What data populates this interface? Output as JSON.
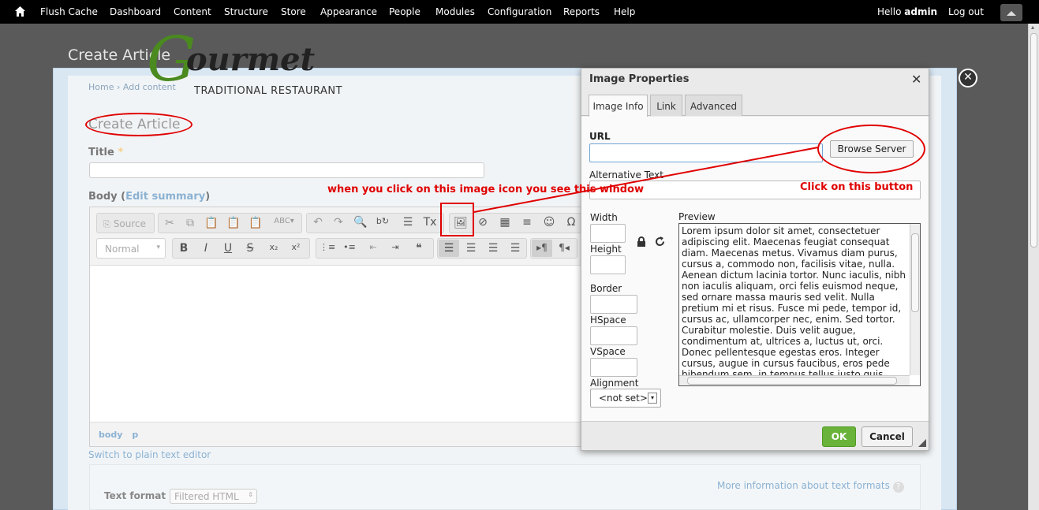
{
  "toolbar": {
    "items": [
      "Flush Cache",
      "Dashboard",
      "Content",
      "Structure",
      "Store",
      "Appearance",
      "People",
      "Modules",
      "Configuration",
      "Reports",
      "Help"
    ],
    "hello": "Hello",
    "user": "admin",
    "logout": "Log out"
  },
  "page": {
    "title": "Create Article",
    "breadcrumb": "Home › Add content",
    "heading": "Create Article",
    "title_label": "Title",
    "required_mark": "*",
    "body_label": "Body (",
    "edit_summary": "Edit summary",
    "body_label_end": ")",
    "switch_editor": "Switch to plain text editor",
    "text_format_label": "Text format",
    "text_format_value": "Filtered HTML",
    "more_info": "More information about text formats"
  },
  "logo": {
    "initial": "G",
    "rest": "ourmet",
    "subtitle": "TRADITIONAL RESTAURANT"
  },
  "editor": {
    "source": "Source",
    "format": "Normal",
    "path": [
      "body",
      "p"
    ]
  },
  "annotations": {
    "image_icon_note": "when you click on this image icon you see this window",
    "button_note": "Click on this button"
  },
  "dialog": {
    "title": "Image Properties",
    "tabs": [
      "Image Info",
      "Link",
      "Advanced"
    ],
    "url_label": "URL",
    "browse_button": "Browse Server",
    "alt_label": "Alternative Text",
    "width_label": "Width",
    "height_label": "Height",
    "border_label": "Border",
    "hspace_label": "HSpace",
    "vspace_label": "VSpace",
    "alignment_label": "Alignment",
    "alignment_value": "<not set>",
    "preview_label": "Preview",
    "preview_text": "Lorem ipsum dolor sit amet, consectetuer adipiscing elit. Maecenas feugiat consequat diam. Maecenas metus. Vivamus diam purus, cursus a, commodo non, facilisis vitae, nulla. Aenean dictum lacinia tortor. Nunc iaculis, nibh non iaculis aliquam, orci felis euismod neque, sed ornare massa mauris sed velit. Nulla pretium mi et risus. Fusce mi pede, tempor id, cursus ac, ullamcorper nec, enim. Sed tortor. Curabitur molestie. Duis velit augue, condimentum at, ultrices a, luctus ut, orci. Donec pellentesque egestas eros. Integer cursus, augue in cursus faucibus, eros pede bibendum sem, in tempus tellus justo quis ligula. Etiam eget tortor. Vestibulum rutrum, est ut placerat elementum, lectus",
    "ok": "OK",
    "cancel": "Cancel"
  },
  "colors": {
    "toolbar_bg": "#000000",
    "annotation_red": "#e00000",
    "ok_green": "#6ab33a",
    "logo_green": "#4a8a1f"
  }
}
